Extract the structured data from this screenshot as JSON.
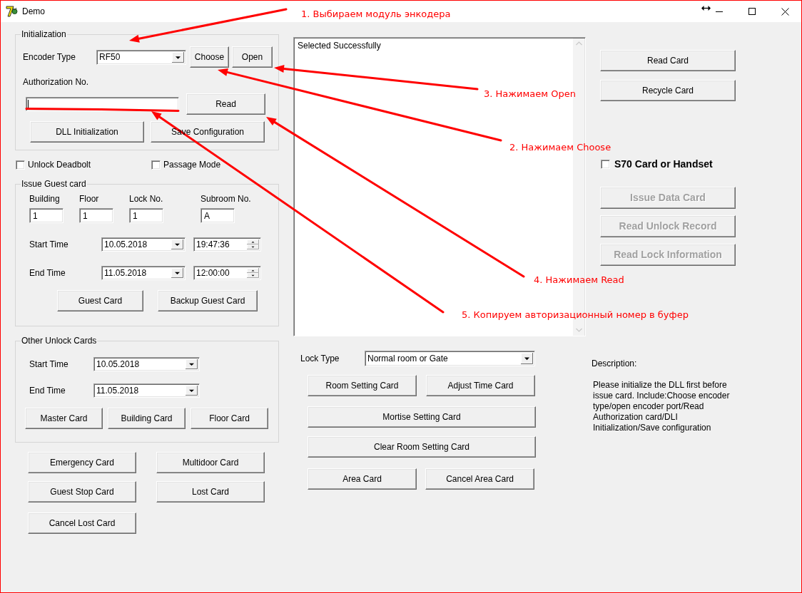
{
  "window": {
    "title": "Demo"
  },
  "initialization": {
    "title": "Initialization",
    "encoder_type": {
      "label": "Encoder Type",
      "value": "RF50"
    },
    "encoder_buttons": [
      "Choose",
      "Open"
    ],
    "authorization": {
      "label": "Authorization No.",
      "focused": true,
      "button": "Read"
    },
    "buttons": [
      "DLL Initialization",
      "Save Configuration"
    ]
  },
  "options": [
    {
      "label": "Unlock Deadbolt",
      "checked": false
    },
    {
      "label": "Passage Mode",
      "checked": false
    }
  ],
  "guest_card": {
    "title": "Issue Guest card",
    "room_fields": [
      {
        "label": "Building",
        "value": "1"
      },
      {
        "label": "Floor",
        "value": "1"
      },
      {
        "label": "Lock No.",
        "value": "1"
      },
      {
        "label": "Subroom No.",
        "value": "A"
      }
    ],
    "times": [
      {
        "label": "Start Time",
        "date": "10.05.2018",
        "time": "19:47:36"
      },
      {
        "label": "End Time",
        "date": "11.05.2018",
        "time": "12:00:00"
      }
    ],
    "buttons": [
      "Guest Card",
      "Backup Guest Card"
    ]
  },
  "other_unlock_cards": {
    "title": "Other Unlock Cards",
    "times": [
      {
        "label": "Start Time",
        "date": "10.05.2018"
      },
      {
        "label": "End Time",
        "date": "11.05.2018"
      }
    ],
    "buttons": [
      "Master Card",
      "Building Card",
      "Floor Card"
    ]
  },
  "card_buttons": [
    [
      "Emergency Card",
      "Multidoor Card"
    ],
    [
      "Guest Stop Card",
      "Lost Card"
    ],
    [
      "Cancel Lost Card"
    ]
  ],
  "log": {
    "text": "Selected Successfully"
  },
  "lock_type": {
    "label": "Lock Type",
    "value": "Normal room or Gate"
  },
  "setting_buttons": [
    [
      "Room Setting Card",
      "Adjust Time Card"
    ],
    [
      "Mortise Setting Card"
    ],
    [
      "Clear Room Setting Card"
    ],
    [
      "Area Card",
      "Cancel Area Card"
    ]
  ],
  "read_buttons": [
    "Read Card",
    "Recycle Card"
  ],
  "s70": {
    "label": "S70 Card or Handset",
    "checked": false
  },
  "data_buttons": [
    {
      "label": "Issue Data Card",
      "disabled": true
    },
    {
      "label": "Read Unlock Record",
      "disabled": true
    },
    {
      "label": "Read Lock Information",
      "disabled": true
    }
  ],
  "description": {
    "title": "Description:",
    "text": "Please initialize the DLL first before issue card. Include:Choose encoder type/open encoder port/Read Authorization card/DLI Initialization/Save configuration"
  },
  "annotations": [
    "1. Выбираем модуль энкодера",
    "3. Нажимаем Open",
    "2. Нажимаем Choose",
    "4. Нажимаем Read",
    "5. Копируем авторизационный номер в буфер"
  ]
}
